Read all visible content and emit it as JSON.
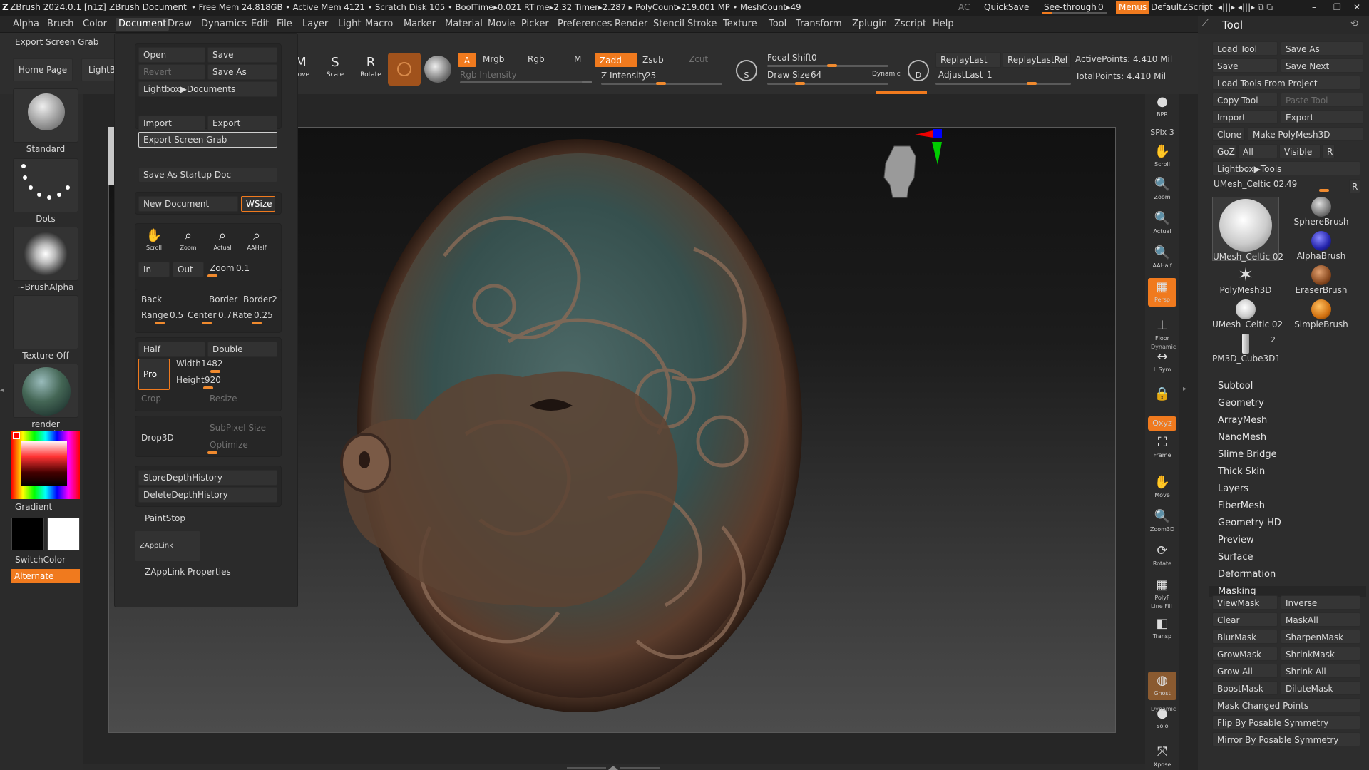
{
  "titlebar": {
    "app": "ZBrush 2024.0.1 [n1z]",
    "document": "ZBrush Document",
    "stats": "• Free Mem 24.818GB • Active Mem 4121 • Scratch Disk 105 • BoolTime▸0.021 RTime▸2.32 Timer▸2.287 ▸ PolyCount▸219.001 MP • MeshCount▸49",
    "ac": "AC",
    "quicksave": "QuickSave",
    "see_through_label": "See-through",
    "see_through_value": "0",
    "menus_label": "Menus",
    "zscript": "DefaultZScript"
  },
  "menubar": [
    "Alpha",
    "Brush",
    "Color",
    "Document",
    "Draw",
    "Dynamics",
    "Edit",
    "File",
    "Layer",
    "Light",
    "Macro",
    "Marker",
    "Material",
    "Movie",
    "Picker",
    "Preferences",
    "Render",
    "Stencil",
    "Stroke",
    "Texture",
    "Tool",
    "Transform",
    "Zplugin",
    "Zscript",
    "Help"
  ],
  "tooltip_title": "Export Screen Grab",
  "left_tabs": {
    "home": "Home Page",
    "lightbox": "LightBox"
  },
  "toolbar": {
    "move": "Move",
    "scale": "Scale",
    "rotate": "Rotate",
    "a": "A",
    "mrgb": "Mrgb",
    "rgb": "Rgb",
    "m": "M",
    "zadd": "Zadd",
    "zsub": "Zsub",
    "zcut": "Zcut",
    "rgb_intensity": "Rgb Intensity",
    "z_intensity_label": "Z Intensity",
    "z_intensity": "25",
    "focal_shift_label": "Focal Shift",
    "focal_shift": "0",
    "draw_size_label": "Draw Size",
    "draw_size": "64",
    "dynamic": "Dynamic",
    "replay_last": "ReplayLast",
    "replay_last_rel": "ReplayLastRel",
    "adjust_last_label": "AdjustLast",
    "adjust_last": "1",
    "active_points": "ActivePoints: 4.410 Mil",
    "total_points": "TotalPoints: 4.410 Mil",
    "s": "S",
    "d": "D"
  },
  "document_menu": {
    "open": "Open",
    "save": "Save",
    "revert": "Revert",
    "save_as": "Save As",
    "lightbox_documents": "Lightbox▶Documents",
    "import": "Import",
    "export": "Export",
    "export_screen_grab": "Export Screen Grab",
    "save_as_startup": "Save As Startup Doc",
    "new_document": "New Document",
    "wsize": "WSize",
    "scroll": "Scroll",
    "zoom": "Zoom",
    "actual": "Actual",
    "aahalf": "AAHalf",
    "in": "In",
    "out": "Out",
    "zoom_label": "Zoom",
    "zoom_value": "0.1",
    "back": "Back",
    "border": "Border",
    "border2": "Border2",
    "range_label": "Range",
    "range": "0.5",
    "center_label": "Center",
    "center": "0.7",
    "rate_label": "Rate",
    "rate": "0.25",
    "half": "Half",
    "double": "Double",
    "pro": "Pro",
    "width_label": "Width",
    "width": "1482",
    "height_label": "Height",
    "height": "920",
    "crop": "Crop",
    "resize": "Resize",
    "drop3d": "Drop3D",
    "subpixel": "SubPixel Size",
    "optimize": "Optimize",
    "store_depth": "StoreDepthHistory",
    "delete_depth": "DeleteDepthHistory",
    "paintstop": "PaintStop",
    "zapplink": "ZAppLink",
    "zapplink_props": "ZAppLink Properties"
  },
  "left_shelf": {
    "brush": "Standard",
    "stroke": "Dots",
    "alpha": "~BrushAlpha",
    "texture": "Texture Off",
    "material": "render material",
    "gradient": "Gradient",
    "switch_color": "SwitchColor",
    "alternate": "Alternate"
  },
  "right_strip": [
    {
      "label": "BPR",
      "glyph": "●"
    },
    {
      "label": "SPix 3",
      "glyph": ""
    },
    {
      "label": "Scroll",
      "glyph": "✋"
    },
    {
      "label": "Zoom",
      "glyph": "🔍"
    },
    {
      "label": "Actual",
      "glyph": "🔍"
    },
    {
      "label": "AAHalf",
      "glyph": "🔍"
    },
    {
      "label": "Persp",
      "glyph": "▦"
    },
    {
      "label": "Floor",
      "glyph": "⊥"
    },
    {
      "label": "L.Sym",
      "glyph": "↔"
    },
    {
      "label": "",
      "glyph": "🔒"
    },
    {
      "label": "Qxyz",
      "glyph": ""
    },
    {
      "label": "Frame",
      "glyph": "⛶"
    },
    {
      "label": "Move",
      "glyph": "✋"
    },
    {
      "label": "Zoom3D",
      "glyph": "🔍"
    },
    {
      "label": "Rotate",
      "glyph": "⟳"
    },
    {
      "label": "PolyF",
      "glyph": "▦"
    },
    {
      "label": "Transp",
      "glyph": "◧"
    },
    {
      "label": "Ghost",
      "glyph": "◍"
    },
    {
      "label": "Solo",
      "glyph": "●"
    },
    {
      "label": "Xpose",
      "glyph": "⤧"
    }
  ],
  "right_strip_extras": {
    "dynamic": "Dynamic",
    "line_fill": "Line Fill"
  },
  "tool_palette": {
    "title": "Tool",
    "buttons": [
      [
        "Load Tool",
        "Save As"
      ],
      [
        "Save",
        "Save Next"
      ],
      [
        "Load Tools From Project"
      ],
      [
        "Copy Tool",
        "Paste Tool"
      ],
      [
        "Import",
        "Export"
      ],
      [
        "Clone",
        "Make PolyMesh3D"
      ],
      [
        "GoZ",
        "All",
        "Visible",
        "R"
      ],
      [
        "Lightbox▶Tools"
      ]
    ],
    "current_tool_label": "UMesh_Celtic 02.",
    "current_tool_value": "49",
    "r": "R",
    "brushes": [
      {
        "name": "UMesh_Celtic 02"
      },
      {
        "name": "SphereBrush"
      },
      {
        "name": "AlphaBrush"
      },
      {
        "name": "PolyMesh3D"
      },
      {
        "name": "EraserBrush"
      },
      {
        "name": "UMesh_Celtic 02"
      },
      {
        "name": "SimpleBrush"
      },
      {
        "name": "PM3D_Cube3D1"
      }
    ],
    "badge_2": "2",
    "subpalettes": [
      "Subtool",
      "Geometry",
      "ArrayMesh",
      "NanoMesh",
      "Slime Bridge",
      "Thick Skin",
      "Layers",
      "FiberMesh",
      "Geometry HD",
      "Preview",
      "Surface",
      "Deformation",
      "Masking"
    ],
    "masking": [
      [
        "ViewMask",
        "Inverse"
      ],
      [
        "Clear",
        "MaskAll"
      ],
      [
        "BlurMask",
        "SharpenMask"
      ],
      [
        "GrowMask",
        "ShrinkMask"
      ],
      [
        "Grow All",
        "Shrink All"
      ],
      [
        "BoostMask",
        "DiluteMask"
      ],
      [
        "Mask Changed Points"
      ],
      [
        "Flip By Posable Symmetry"
      ],
      [
        "Mirror By Posable Symmetry"
      ]
    ]
  },
  "colors": {
    "accent": "#f07a1e",
    "bg": "#2b2b2b",
    "panel": "#2d2d2d"
  }
}
